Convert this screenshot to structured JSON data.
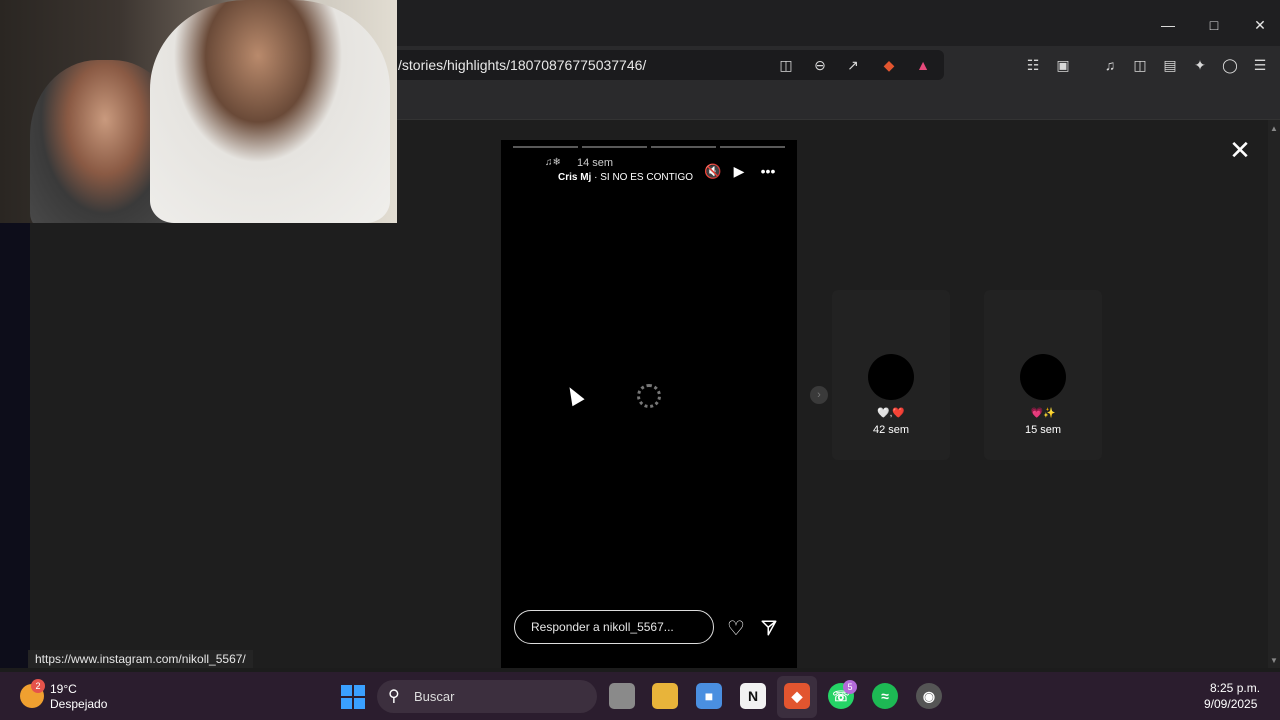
{
  "browser": {
    "url": "/stories/highlights/18070876775037746/"
  },
  "story": {
    "time_ago": "14 sem",
    "username": "Cris Mj",
    "song": " · SI NO ES CONTIGO",
    "reply_placeholder": "Responder a nikoll_5567..."
  },
  "highlights": [
    {
      "emoji": "🤍,❤️",
      "time": "42 sem"
    },
    {
      "emoji": "💗✨",
      "time": "15 sem"
    }
  ],
  "status_url": "https://www.instagram.com/nikoll_5567/",
  "taskbar": {
    "weather_badge": "2",
    "temperature": "19°C",
    "condition": "Despejado",
    "search_label": "Buscar",
    "whatsapp_badge": "5",
    "time": "8:25 p.m.",
    "date": "9/09/2025"
  },
  "colors": {
    "accent_start": "#3aa0ff",
    "brave": "#e2552f",
    "whatsapp": "#25d366",
    "spotify": "#1db954"
  }
}
